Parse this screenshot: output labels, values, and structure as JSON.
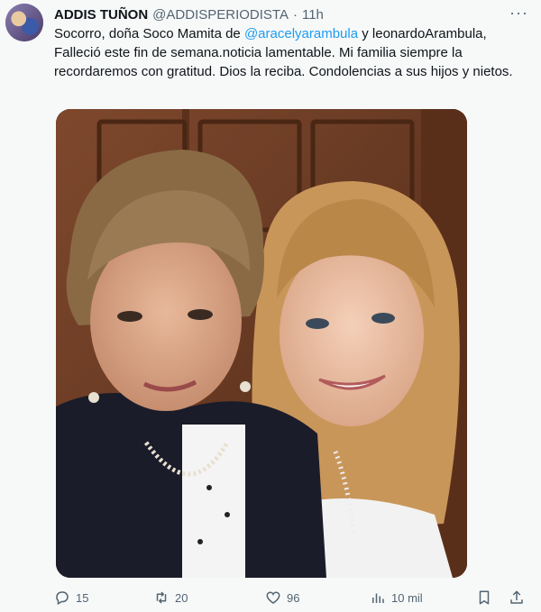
{
  "author": {
    "name": "ADDIS TUÑON",
    "handle": "@ADDISPERIODISTA",
    "separator": "·",
    "time": "11h"
  },
  "tweet": {
    "text_part1": "Socorro, doña Soco Mamita de ",
    "mention": "@aracelyarambula",
    "text_part2": "  y leonardoArambula, Falleció este fin de semana.noticia lamentable. Mi familia siempre la recordaremos con gratitud. Dios la reciba. Condolencias a sus hijos y nietos."
  },
  "actions": {
    "replies": "15",
    "retweets": "20",
    "likes": "96",
    "views": "10 mil"
  },
  "more_label": "···",
  "icons": {
    "reply": "reply-icon",
    "retweet": "retweet-icon",
    "like": "heart-icon",
    "views": "views-icon",
    "bookmark": "bookmark-icon",
    "share": "share-icon"
  },
  "colors": {
    "accent": "#1d9bf0",
    "muted": "#536471",
    "text": "#0f1419",
    "background": "#f7f9f9"
  }
}
